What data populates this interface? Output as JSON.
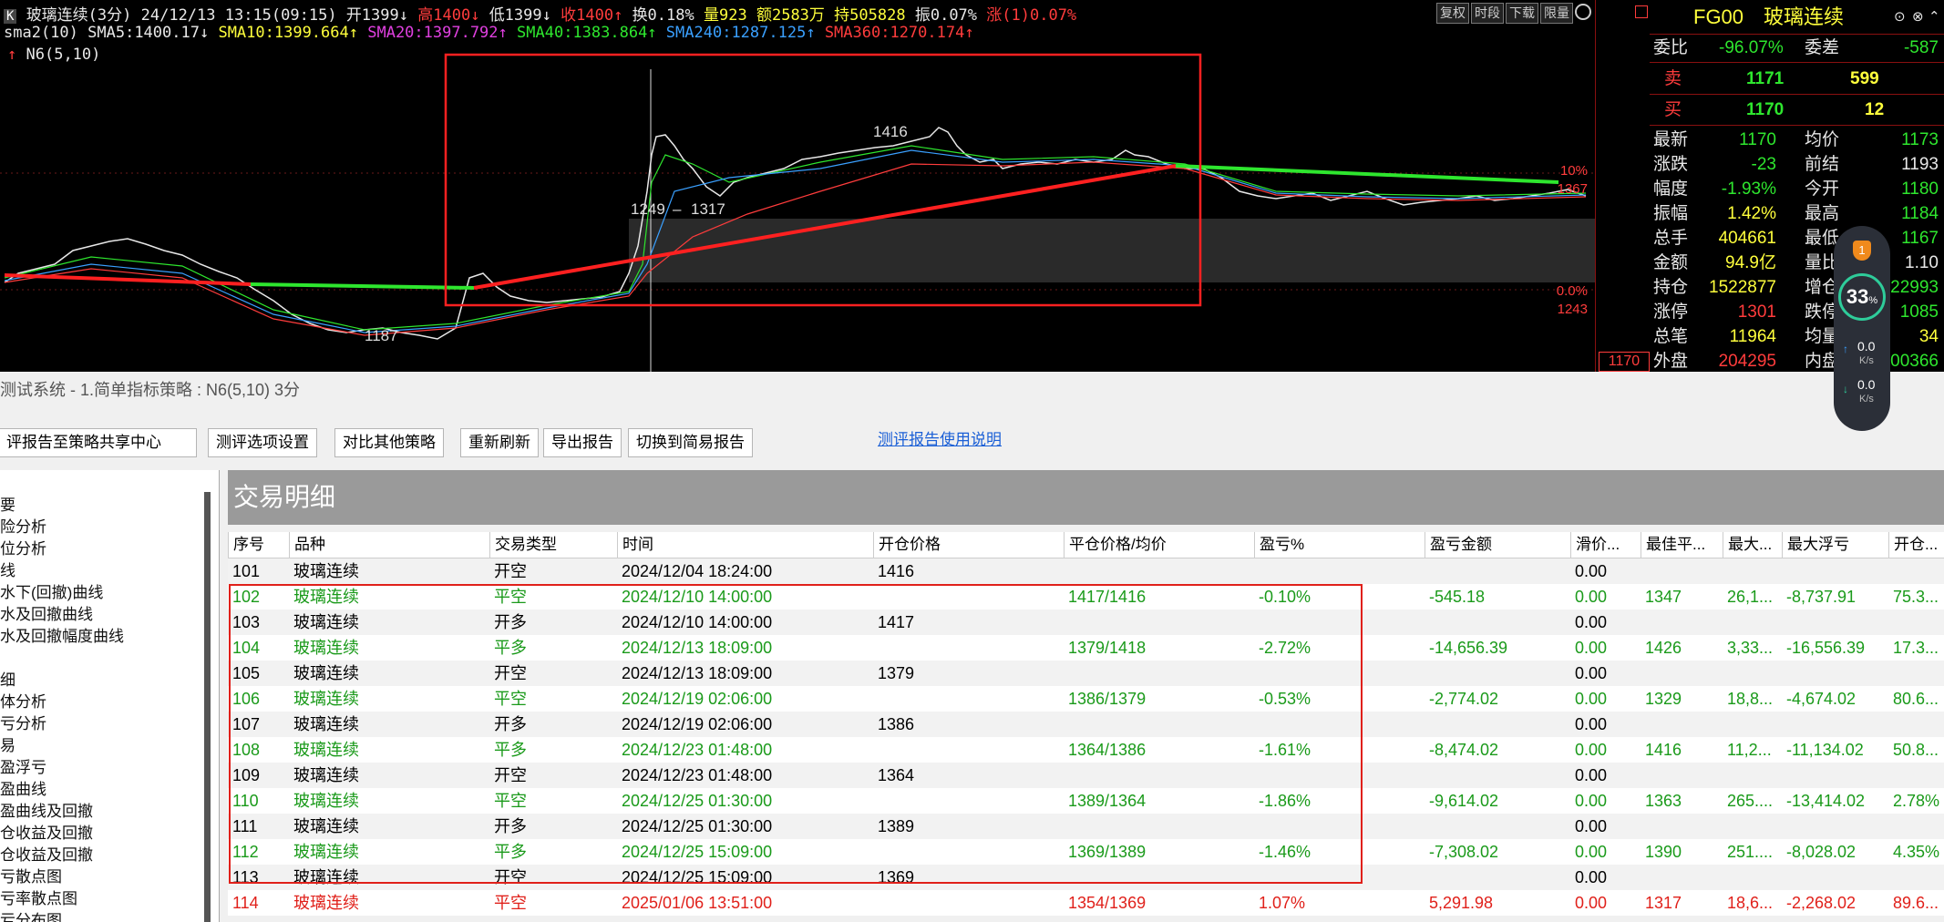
{
  "chart": {
    "window_icon": "K",
    "title_line": "玻璃连续(3分) 24/12/13 13:15(09:15)",
    "open": "开1399↓",
    "high": "高1400↓",
    "low": "低1399↓",
    "close": "收1400↑",
    "turnover": "换0.18%",
    "volume": "量923",
    "amount": "额2583万",
    "position": "持505828",
    "amplitude": "振0.07%",
    "rise": "涨(1)0.07%",
    "ind_name": "sma2(10)",
    "sma5": "SMA5:1400.17↓",
    "sma10": "SMA10:1399.664↑",
    "sma20": "SMA20:1397.792↑",
    "sma40": "SMA40:1383.864↑",
    "sma240": "SMA240:1287.125↑",
    "sma360": "SMA360:1270.174↑",
    "n6": "N6(5,10)",
    "tool_buttons": [
      "复权",
      "时段",
      "下载",
      "限量"
    ],
    "labels": {
      "p1416": "1416",
      "p1249": "1249",
      "p1317": "1317",
      "p1187": "1187"
    },
    "axis": {
      "pct_top": "10%",
      "price_top": "1367",
      "pct_zero": "0.0%",
      "price_zero": "1243",
      "current": "1170"
    },
    "colors": {
      "sma5": "#e8e8e8",
      "sma10": "#ffff3c",
      "sma20": "#e040e0",
      "sma40": "#2ee62e",
      "sma240": "#3aa0ff",
      "sma360": "#ff3c3c"
    }
  },
  "quote": {
    "code": "FG00",
    "name": "玻璃连续",
    "weibi_label": "委比",
    "weibi": "-96.07%",
    "weicha_label": "委差",
    "weicha": "-587",
    "sell_label": "卖",
    "sell_price": "1171",
    "sell_vol": "599",
    "buy_label": "买",
    "buy_price": "1170",
    "buy_vol": "12",
    "rows": [
      {
        "l1": "最新",
        "v1": "1170",
        "l2": "均价",
        "v2": "1173"
      },
      {
        "l1": "涨跌",
        "v1": "-23",
        "l2": "前结",
        "v2": "1193"
      },
      {
        "l1": "幅度",
        "v1": "-1.93%",
        "l2": "今开",
        "v2": "1180"
      },
      {
        "l1": "振幅",
        "v1": "1.42%",
        "l2": "最高",
        "v2": "1184"
      },
      {
        "l1": "总手",
        "v1": "404661",
        "l2": "最低",
        "v2": "1167"
      },
      {
        "l1": "金额",
        "v1": "94.9亿",
        "l2": "量比",
        "v2": "1.10"
      },
      {
        "l1": "持仓",
        "v1": "1522877",
        "l2": "增仓",
        "v2": "22993"
      },
      {
        "l1": "涨停",
        "v1": "1301",
        "l2": "跌停",
        "v2": "1085"
      },
      {
        "l1": "总笔",
        "v1": "11964",
        "l2": "均量",
        "v2": "34"
      },
      {
        "l1": "外盘",
        "v1": "204295",
        "l2": "内盘",
        "v2": "00366"
      }
    ]
  },
  "widget": {
    "badge": "1",
    "percent": "33",
    "unit": "%",
    "up_speed": "0.0",
    "up_unit": "K/s",
    "down_speed": "0.0",
    "down_unit": "K/s"
  },
  "report": {
    "title": "测试系统 - 1.简单指标策略 : N6(5,10) 3分",
    "buttons": [
      "评报告至策略共享中心",
      "测评选项设置",
      "对比其他策略",
      "重新刷新",
      "导出报告",
      "切换到简易报告"
    ],
    "help_link": "测评报告使用说明",
    "tree": [
      "要",
      "险分析",
      "位分析",
      "线",
      "水下(回撤)曲线",
      "水及回撤曲线",
      "水及回撤幅度曲线",
      "",
      "细",
      "体分析",
      "亏分析",
      "易",
      "盈浮亏",
      "盈曲线",
      "盈曲线及回撤",
      "仓收益及回撤",
      "仓收益及回撤",
      "亏散点图",
      "亏率散点图",
      "亏分布图"
    ],
    "panel_title": "交易明细",
    "columns": [
      "序号",
      "品种",
      "交易类型",
      "时间",
      "开仓价格",
      "平仓价格/均价",
      "盈亏%",
      "盈亏金额",
      "滑价...",
      "最佳平...",
      "最大...",
      "最大浮亏",
      "开仓..."
    ],
    "rows": [
      {
        "no": "101",
        "sym": "玻璃连续",
        "type": "开空",
        "time": "2024/12/04 18:24:00",
        "open": "1416",
        "close": "",
        "pct": "",
        "amt": "",
        "slip": "0.00",
        "best": "",
        "maxp": "",
        "maxl": "",
        "extra": "",
        "kind": "open"
      },
      {
        "no": "102",
        "sym": "玻璃连续",
        "type": "平空",
        "time": "2024/12/10 14:00:00",
        "open": "",
        "close": "1417/1416",
        "pct": "-0.10%",
        "amt": "-545.18",
        "slip": "0.00",
        "best": "1347",
        "maxp": "26,1...",
        "maxl": "-8,737.91",
        "extra": "75.3...",
        "kind": "loss"
      },
      {
        "no": "103",
        "sym": "玻璃连续",
        "type": "开多",
        "time": "2024/12/10 14:00:00",
        "open": "1417",
        "close": "",
        "pct": "",
        "amt": "",
        "slip": "0.00",
        "best": "",
        "maxp": "",
        "maxl": "",
        "extra": "",
        "kind": "open"
      },
      {
        "no": "104",
        "sym": "玻璃连续",
        "type": "平多",
        "time": "2024/12/13 18:09:00",
        "open": "",
        "close": "1379/1418",
        "pct": "-2.72%",
        "amt": "-14,656.39",
        "slip": "0.00",
        "best": "1426",
        "maxp": "3,33...",
        "maxl": "-16,556.39",
        "extra": "17.3...",
        "kind": "loss"
      },
      {
        "no": "105",
        "sym": "玻璃连续",
        "type": "开空",
        "time": "2024/12/13 18:09:00",
        "open": "1379",
        "close": "",
        "pct": "",
        "amt": "",
        "slip": "0.00",
        "best": "",
        "maxp": "",
        "maxl": "",
        "extra": "",
        "kind": "open"
      },
      {
        "no": "106",
        "sym": "玻璃连续",
        "type": "平空",
        "time": "2024/12/19 02:06:00",
        "open": "",
        "close": "1386/1379",
        "pct": "-0.53%",
        "amt": "-2,774.02",
        "slip": "0.00",
        "best": "1329",
        "maxp": "18,8...",
        "maxl": "-4,674.02",
        "extra": "80.6...",
        "kind": "loss"
      },
      {
        "no": "107",
        "sym": "玻璃连续",
        "type": "开多",
        "time": "2024/12/19 02:06:00",
        "open": "1386",
        "close": "",
        "pct": "",
        "amt": "",
        "slip": "0.00",
        "best": "",
        "maxp": "",
        "maxl": "",
        "extra": "",
        "kind": "open"
      },
      {
        "no": "108",
        "sym": "玻璃连续",
        "type": "平多",
        "time": "2024/12/23 01:48:00",
        "open": "",
        "close": "1364/1386",
        "pct": "-1.61%",
        "amt": "-8,474.02",
        "slip": "0.00",
        "best": "1416",
        "maxp": "11,2...",
        "maxl": "-11,134.02",
        "extra": "50.8...",
        "kind": "loss"
      },
      {
        "no": "109",
        "sym": "玻璃连续",
        "type": "开空",
        "time": "2024/12/23 01:48:00",
        "open": "1364",
        "close": "",
        "pct": "",
        "amt": "",
        "slip": "0.00",
        "best": "",
        "maxp": "",
        "maxl": "",
        "extra": "",
        "kind": "open"
      },
      {
        "no": "110",
        "sym": "玻璃连续",
        "type": "平空",
        "time": "2024/12/25 01:30:00",
        "open": "",
        "close": "1389/1364",
        "pct": "-1.86%",
        "amt": "-9,614.02",
        "slip": "0.00",
        "best": "1363",
        "maxp": "265....",
        "maxl": "-13,414.02",
        "extra": "2.78%",
        "kind": "loss"
      },
      {
        "no": "111",
        "sym": "玻璃连续",
        "type": "开多",
        "time": "2024/12/25 01:30:00",
        "open": "1389",
        "close": "",
        "pct": "",
        "amt": "",
        "slip": "0.00",
        "best": "",
        "maxp": "",
        "maxl": "",
        "extra": "",
        "kind": "open"
      },
      {
        "no": "112",
        "sym": "玻璃连续",
        "type": "平多",
        "time": "2024/12/25 15:09:00",
        "open": "",
        "close": "1369/1389",
        "pct": "-1.46%",
        "amt": "-7,308.02",
        "slip": "0.00",
        "best": "1390",
        "maxp": "251....",
        "maxl": "-8,028.02",
        "extra": "4.35%",
        "kind": "loss"
      },
      {
        "no": "113",
        "sym": "玻璃连续",
        "type": "开空",
        "time": "2024/12/25 15:09:00",
        "open": "1369",
        "close": "",
        "pct": "",
        "amt": "",
        "slip": "0.00",
        "best": "",
        "maxp": "",
        "maxl": "",
        "extra": "",
        "kind": "open"
      },
      {
        "no": "114",
        "sym": "玻璃连续",
        "type": "平空",
        "time": "2025/01/06 13:51:00",
        "open": "",
        "close": "1354/1369",
        "pct": "1.07%",
        "amt": "5,291.98",
        "slip": "0.00",
        "best": "1317",
        "maxp": "18,6...",
        "maxl": "-2,268.02",
        "extra": "89.6...",
        "kind": "gain"
      }
    ],
    "colors": {
      "loss": "#1a9a1a",
      "gain": "#e0201a",
      "open": "#000000"
    }
  }
}
